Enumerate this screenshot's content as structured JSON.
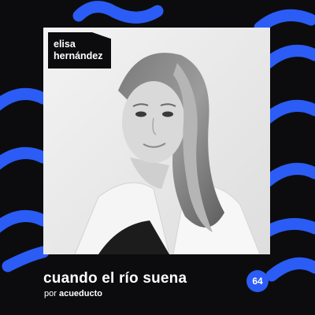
{
  "guest": {
    "first_name": "elisa",
    "last_name": "hernández"
  },
  "episode": {
    "show_title": "cuando el río suena",
    "by_prefix": "por",
    "brand": "acueducto",
    "number": "64"
  },
  "colors": {
    "background": "#0c0c0e",
    "accent_blue": "#2b5cf5",
    "text": "#ffffff"
  }
}
